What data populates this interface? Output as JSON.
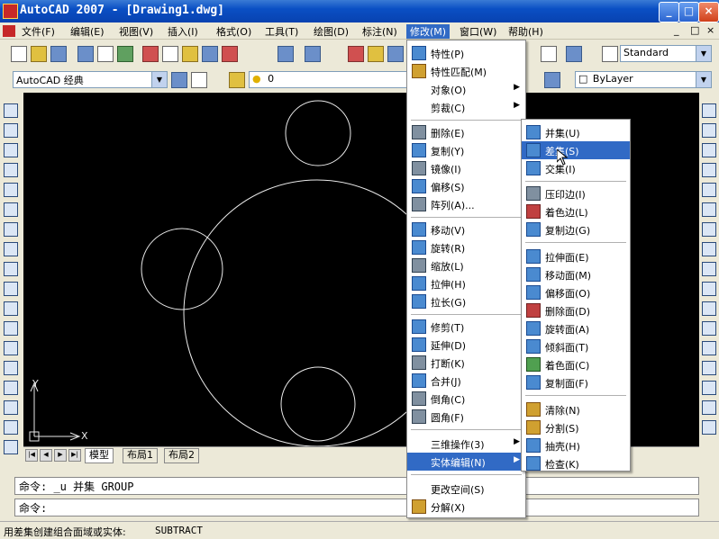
{
  "title_bar": {
    "title": "AutoCAD 2007 - [Drawing1.dwg]",
    "min": "_",
    "max": "□",
    "close": "×"
  },
  "menu_bar": {
    "items": [
      "文件(F)",
      "编辑(E)",
      "视图(V)",
      "插入(I)",
      "格式(O)",
      "工具(T)",
      "绘图(D)",
      "标注(N)",
      "修改(M)",
      "窗口(W)",
      "帮助(H)"
    ],
    "doc_controls": [
      "_",
      "□",
      "×"
    ]
  },
  "toolbar": {
    "workspace": "AutoCAD 经典",
    "layer_value": "0",
    "text_style": "Standard",
    "linetype": "ByLayer"
  },
  "modify_menu": {
    "groups": [
      [
        "特性(P)",
        "特性匹配(M)",
        "对象(O)",
        "剪裁(C)"
      ],
      [
        "删除(E)",
        "复制(Y)",
        "镜像(I)",
        "偏移(S)",
        "阵列(A)..."
      ],
      [
        "移动(V)",
        "旋转(R)",
        "缩放(L)",
        "拉伸(H)",
        "拉长(G)"
      ],
      [
        "修剪(T)",
        "延伸(D)",
        "打断(K)",
        "合并(J)",
        "倒角(C)",
        "圆角(F)"
      ],
      [
        "三维操作(3)",
        "实体编辑(N)"
      ],
      [
        "更改空间(S)",
        "分解(X)"
      ]
    ]
  },
  "solid_edit_menu": {
    "groups": [
      [
        "并集(U)",
        "差集(S)",
        "交集(I)"
      ],
      [
        "压印边(I)",
        "着色边(L)",
        "复制边(G)"
      ],
      [
        "拉伸面(E)",
        "移动面(M)",
        "偏移面(O)",
        "删除面(D)",
        "旋转面(A)",
        "倾斜面(T)",
        "着色面(C)",
        "复制面(F)"
      ],
      [
        "清除(N)",
        "分割(S)",
        "抽壳(H)",
        "检查(K)"
      ]
    ]
  },
  "layout_tabs": [
    "模型",
    "布局1",
    "布局2"
  ],
  "ucs": {
    "x": "X",
    "y": "Y"
  },
  "command": {
    "line1": "命令: _u 并集 GROUP",
    "line2": "命令:"
  },
  "status": {
    "text": "用差集创建组合面域或实体:",
    "command": "SUBTRACT"
  },
  "colors": {
    "highlight": "#316ac5",
    "canvas": "#000000",
    "title": "#0a4fc4"
  }
}
